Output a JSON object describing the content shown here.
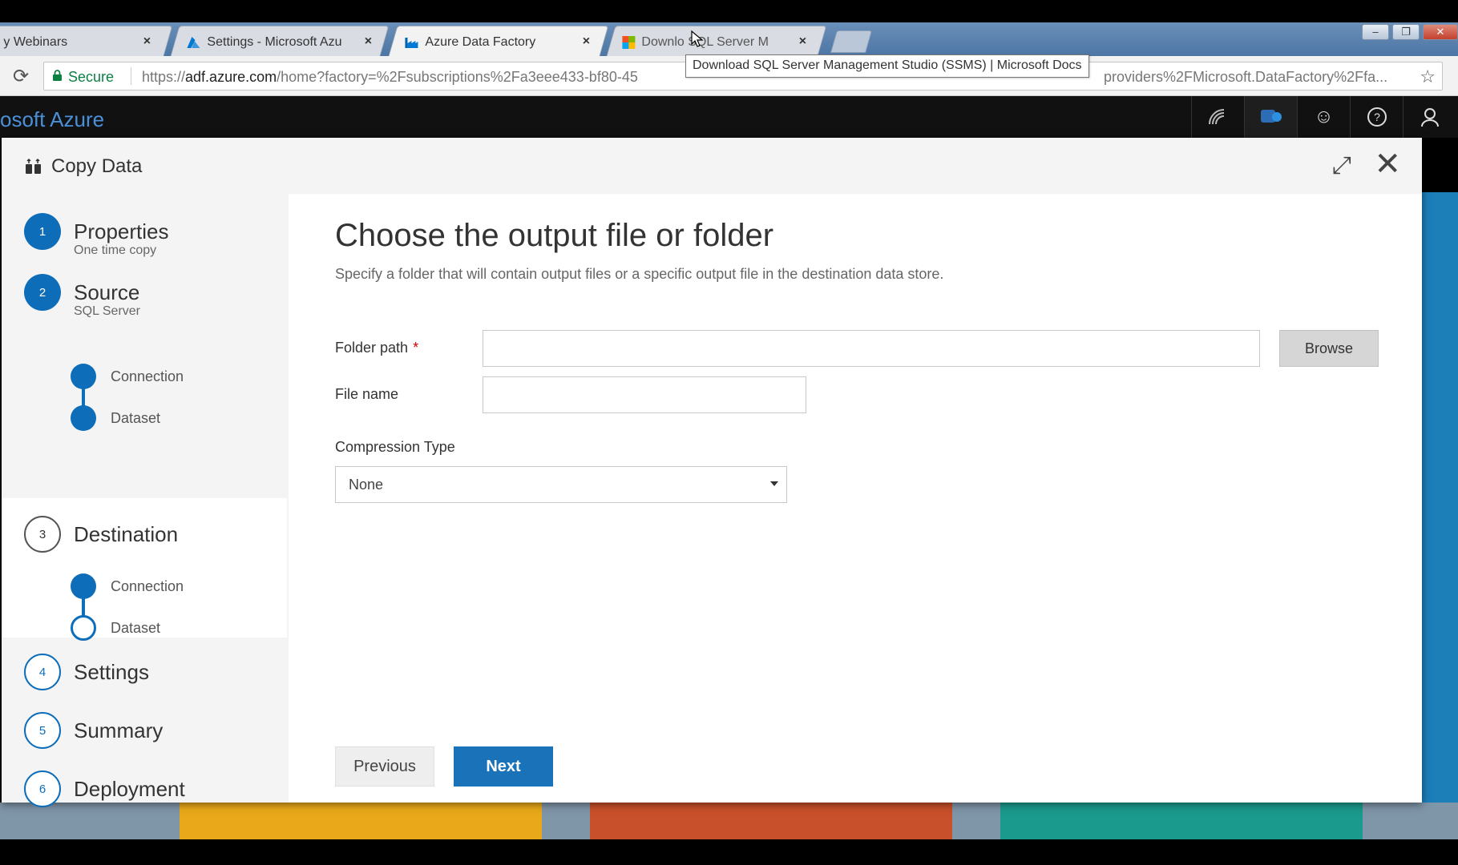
{
  "browser": {
    "tabs": [
      {
        "title": "y Webinars",
        "close": "×"
      },
      {
        "title": "Settings - Microsoft Azu",
        "close": "×"
      },
      {
        "title": "Azure Data Factory",
        "close": "×"
      },
      {
        "title": "Downlo SQL Server M",
        "close": "×"
      }
    ],
    "tooltip": "Download SQL Server Management Studio (SSMS) | Microsoft Docs",
    "address": {
      "secure_label": "Secure",
      "url_scheme": "https://",
      "url_host": "adf.azure.com",
      "url_rest": "/home?factory=%2Fsubscriptions%2Fa3eee433-bf80-45",
      "url_tail": "providers%2FMicrosoft.DataFactory%2Ffa..."
    },
    "window_controls": {
      "minimize": "–",
      "maximize": "❐",
      "close": "✕"
    }
  },
  "azure": {
    "brand": "osoft Azure"
  },
  "dialog": {
    "title": "Copy Data",
    "steps": [
      {
        "number": "1",
        "label": "Properties",
        "sub": "One time copy",
        "state": "done"
      },
      {
        "number": "2",
        "label": "Source",
        "sub": "SQL Server",
        "state": "done"
      },
      {
        "number": "3",
        "label": "Destination",
        "sub": "",
        "state": "current"
      },
      {
        "number": "4",
        "label": "Settings",
        "sub": "",
        "state": "todo"
      },
      {
        "number": "5",
        "label": "Summary",
        "sub": "",
        "state": "todo"
      },
      {
        "number": "6",
        "label": "Deployment",
        "sub": "",
        "state": "todo"
      }
    ],
    "source_substeps": [
      "Connection",
      "Dataset"
    ],
    "destination_substeps": [
      "Connection",
      "Dataset"
    ],
    "panel": {
      "title": "Choose the output file or folder",
      "description": "Specify a folder that will contain output files or a specific output file in the destination data store.",
      "folder_path_label": "Folder path",
      "required_mark": "*",
      "folder_path_value": "",
      "browse_label": "Browse",
      "file_name_label": "File name",
      "file_name_value": "",
      "compression_label": "Compression Type",
      "compression_value": "None",
      "previous_label": "Previous",
      "next_label": "Next"
    }
  },
  "colors": {
    "accent": "#0e6db8",
    "next_button": "#1a73b8",
    "azure_header": "#111111",
    "tile_yellow": "#e8a81a",
    "tile_orange": "#c8502a",
    "tile_teal": "#1a9a8c"
  }
}
